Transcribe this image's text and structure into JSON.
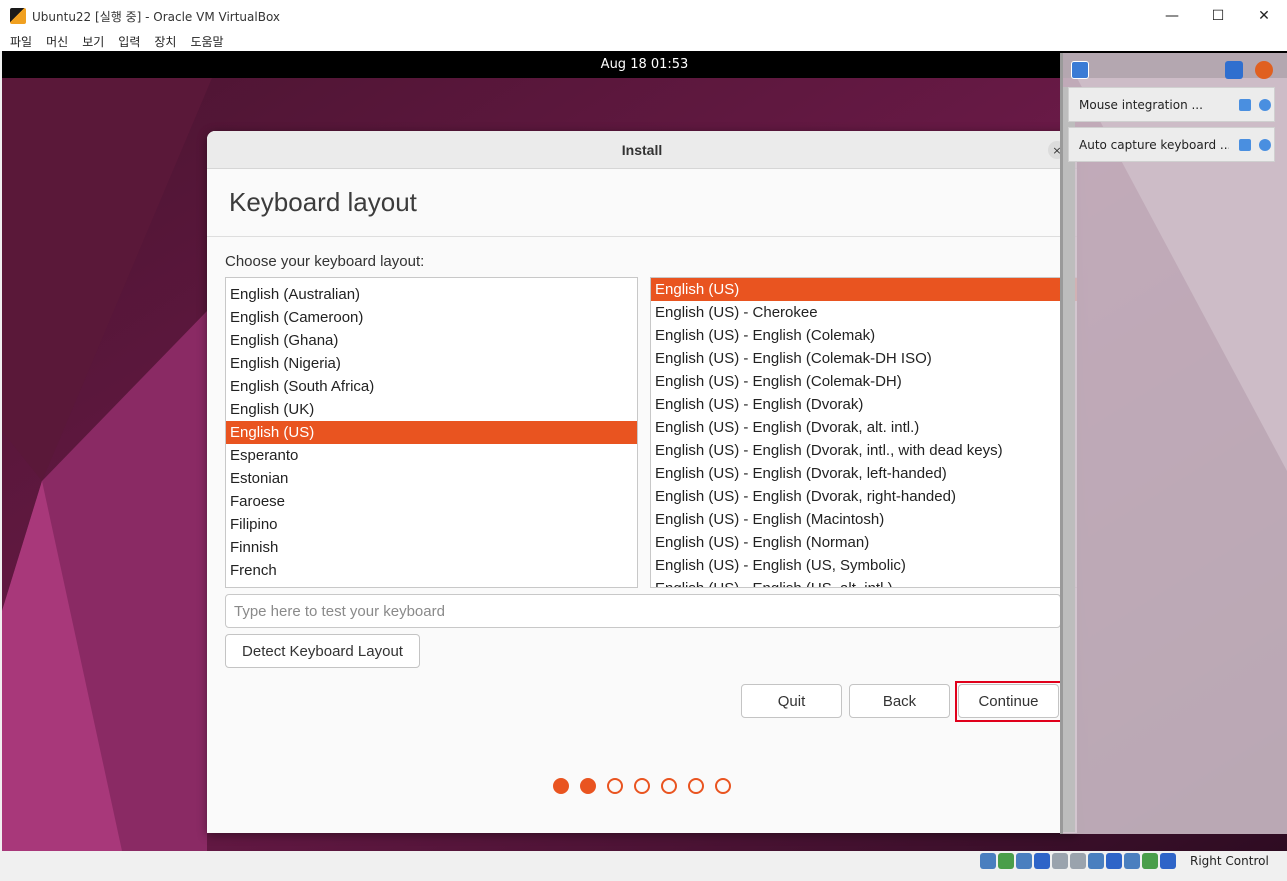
{
  "window": {
    "title": "Ubuntu22 [실행 중] - Oracle VM VirtualBox",
    "minimize": "—",
    "maximize": "☐",
    "close": "✕"
  },
  "menu": [
    "파일",
    "머신",
    "보기",
    "입력",
    "장치",
    "도움말"
  ],
  "guest": {
    "clock": "Aug 18  01:53"
  },
  "dialog": {
    "title": "Install",
    "close": "×",
    "heading": "Keyboard layout",
    "choose_label": "Choose your keyboard layout:",
    "layouts": [
      "English (Australian)",
      "English (Cameroon)",
      "English (Ghana)",
      "English (Nigeria)",
      "English (South Africa)",
      "English (UK)",
      "English (US)",
      "Esperanto",
      "Estonian",
      "Faroese",
      "Filipino",
      "Finnish",
      "French"
    ],
    "selected_layout": "English (US)",
    "variants": [
      "English (US)",
      "English (US) - Cherokee",
      "English (US) - English (Colemak)",
      "English (US) - English (Colemak-DH ISO)",
      "English (US) - English (Colemak-DH)",
      "English (US) - English (Dvorak)",
      "English (US) - English (Dvorak, alt. intl.)",
      "English (US) - English (Dvorak, intl., with dead keys)",
      "English (US) - English (Dvorak, left-handed)",
      "English (US) - English (Dvorak, right-handed)",
      "English (US) - English (Macintosh)",
      "English (US) - English (Norman)",
      "English (US) - English (US, Symbolic)",
      "English (US) - English (US, alt. intl.)"
    ],
    "selected_variant": "English (US)",
    "test_placeholder": "Type here to test your keyboard",
    "test_value": "",
    "detect_button": "Detect Keyboard Layout",
    "quit_button": "Quit",
    "back_button": "Back",
    "continue_button": "Continue",
    "progress": {
      "current_step": 2,
      "total_steps": 7
    },
    "accent_color": "#e95420"
  },
  "notifications": [
    {
      "text": "Mouse integration ..."
    },
    {
      "text": "Auto capture keyboard ..."
    }
  ],
  "statusbar": {
    "host_key": "Right Control"
  },
  "colors": {
    "highlight": "#e0001b"
  }
}
